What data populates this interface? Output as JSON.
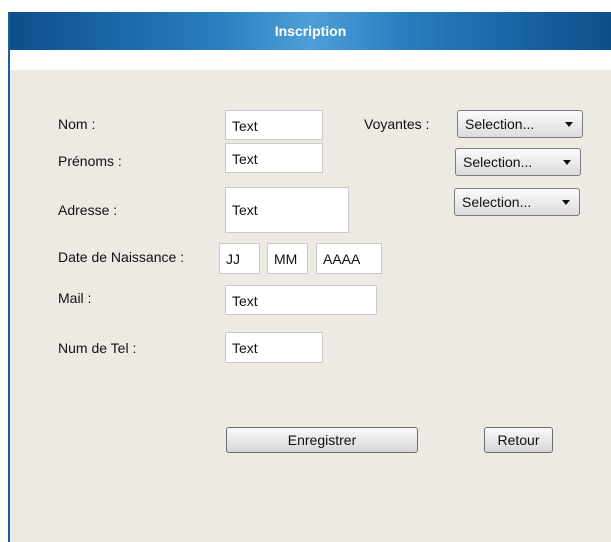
{
  "window": {
    "title": "Inscription"
  },
  "form": {
    "labels": {
      "nom": "Nom :",
      "prenoms": "Prénoms :",
      "adresse": "Adresse :",
      "date_naissance": "Date de Naissance :",
      "mail": "Mail :",
      "num_tel": "Num de Tel :",
      "voyantes": "Voyantes :"
    },
    "fields": {
      "nom": "Text",
      "prenoms": "Text",
      "adresse": "Text",
      "jour": "JJ",
      "mois": "MM",
      "annee": "AAAA",
      "mail": "Text",
      "num_tel": "Text"
    },
    "voyantes_selects": [
      "Selection...",
      "Selection...",
      "Selection..."
    ]
  },
  "buttons": {
    "enregistrer": "Enregistrer",
    "retour": "Retour"
  }
}
